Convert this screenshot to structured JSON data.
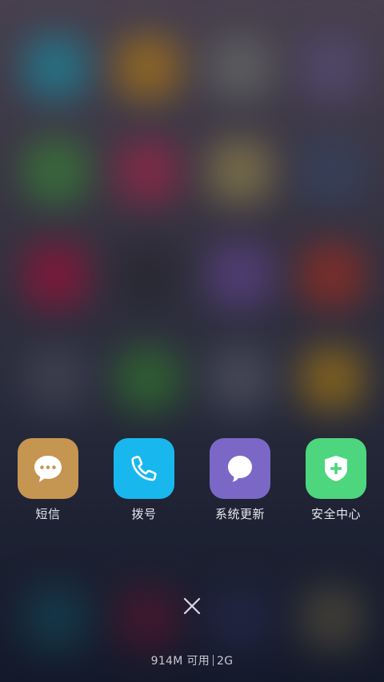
{
  "colors": {
    "sms_icon_bg": "#c59552",
    "dialer_icon_bg": "#18b8ee",
    "update_icon_bg": "#7b68c6",
    "security_icon_bg": "#4dd67d",
    "label_text": "#e8e8ee",
    "memory_text": "#c6c8d2"
  },
  "recent_apps": [
    {
      "label": "短信",
      "icon": "chat-bubble-icon"
    },
    {
      "label": "拨号",
      "icon": "phone-icon"
    },
    {
      "label": "系统更新",
      "icon": "update-bubble-icon"
    },
    {
      "label": "安全中心",
      "icon": "shield-plus-icon"
    }
  ],
  "close_icon": "close-icon",
  "memory": {
    "available": "914M 可用",
    "total": "2G"
  }
}
